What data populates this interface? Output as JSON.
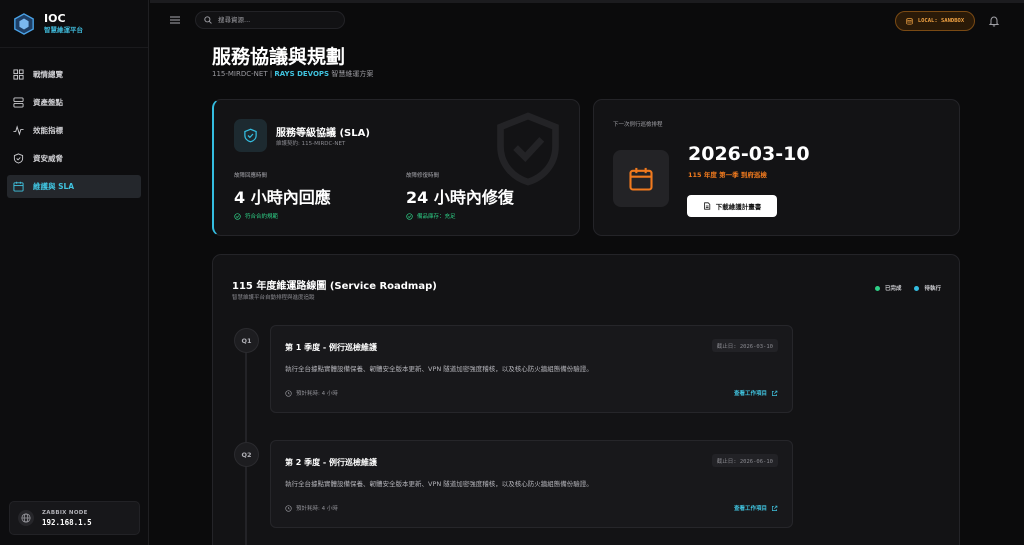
{
  "app": {
    "name": "IOC",
    "subtitle": "智慧維運平台"
  },
  "sidebar": {
    "items": [
      {
        "label": "戰情總覽",
        "icon": "dashboard-icon"
      },
      {
        "label": "資產盤點",
        "icon": "server-icon"
      },
      {
        "label": "效能指標",
        "icon": "activity-icon"
      },
      {
        "label": "資安威脅",
        "icon": "shield-check-icon"
      },
      {
        "label": "維護與 SLA",
        "icon": "calendar-icon",
        "active": true
      }
    ],
    "node": {
      "label": "ZABBIX NODE",
      "ip": "192.168.1.5"
    }
  },
  "topbar": {
    "search_placeholder": "搜尋資源...",
    "env_badge": "LOCAL: SANDBOX"
  },
  "page": {
    "title": "服務協議與規劃",
    "sub_org": "115-MIRDC-NET",
    "sub_sep": " | ",
    "sub_team": "RAYS DEVOPS",
    "sub_desc": " 智慧維運方案"
  },
  "sla": {
    "title": "服務等級協議 (SLA)",
    "contract": "維護契約: 115-MIRDC-NET",
    "response": {
      "label": "故障回應時間",
      "value": "4 小時內回應",
      "status": "符合合約規範"
    },
    "repair": {
      "label": "故障修復時間",
      "value": "24 小時內修復",
      "status": "備品庫存：充足"
    }
  },
  "next": {
    "label": "下一次例行巡檢排程",
    "date": "2026-03-10",
    "quarter": "115 年度 第一季 到府巡檢",
    "download": "下載維護計畫書"
  },
  "roadmap": {
    "title": "115 年度維運路線圖 (Service Roadmap)",
    "subtitle": "智慧維護平台自動排程與進度追蹤",
    "legend": [
      {
        "label": "已完成",
        "color": "#2ecf86"
      },
      {
        "label": "待執行",
        "color": "#34bde0"
      }
    ],
    "tasks": [
      {
        "q": "Q1",
        "title": "第 1 季度 - 例行巡檢維護",
        "deadline": "截止日: 2026-03-10",
        "desc": "執行全台據點實體設備保養、韌體安全版本更新、VPN 隧道加密強度稽核，以及核心防火牆組態備份驗證。",
        "time": "預計耗時: 4 小時",
        "link": "查看工作項目"
      },
      {
        "q": "Q2",
        "title": "第 2 季度 - 例行巡檢維護",
        "deadline": "截止日: 2026-06-10",
        "desc": "執行全台據點實體設備保養、韌體安全版本更新、VPN 隧道加密強度稽核，以及核心防火牆組態備份驗證。",
        "time": "預計耗時: 4 小時",
        "link": "查看工作項目"
      }
    ]
  }
}
